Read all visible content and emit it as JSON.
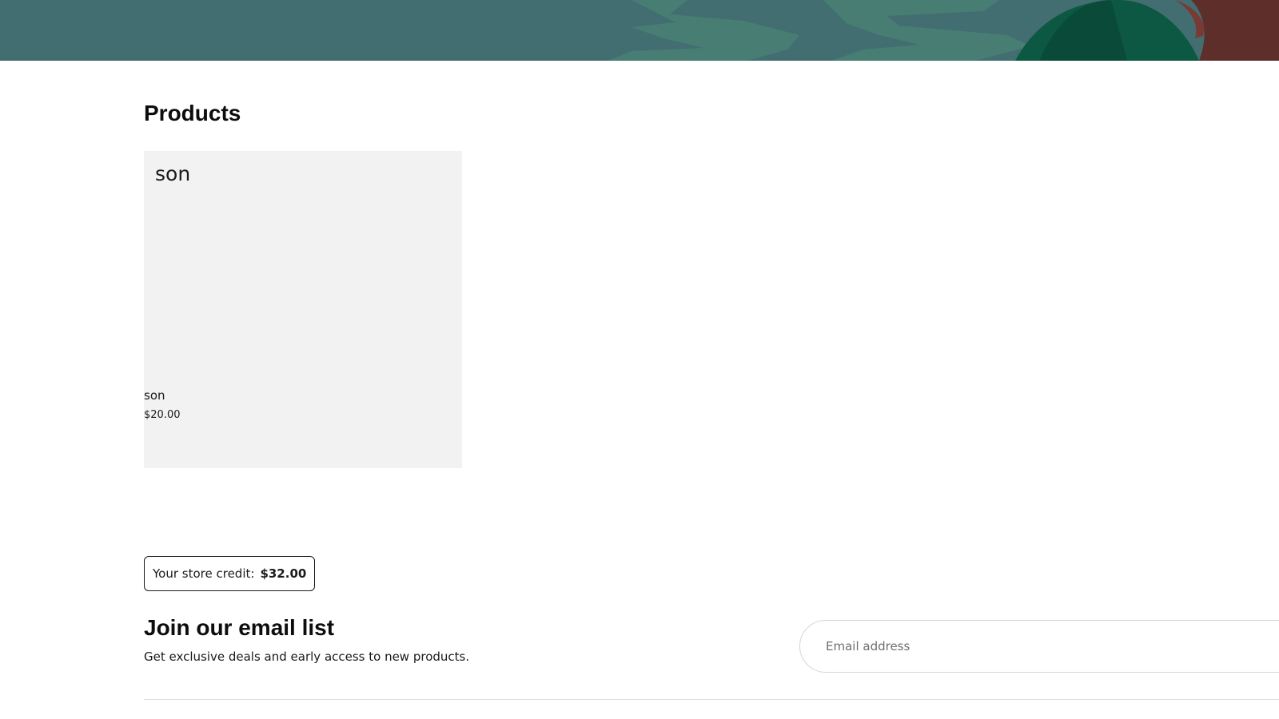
{
  "colors": {
    "banner_bg": "#426e72",
    "banner_leaf_light": "#477d72",
    "banner_leaf_dark": "#0d5842",
    "banner_accent": "#5e2e2b",
    "card_bg": "#f2f2f2"
  },
  "products": {
    "title": "Products",
    "items": [
      {
        "image_text": "son",
        "name": "son",
        "price": "$20.00"
      }
    ]
  },
  "store_credit": {
    "label": "Your store credit:",
    "amount": "$32.00"
  },
  "newsletter": {
    "title": "Join our email list",
    "subtitle": "Get exclusive deals and early access to new products.",
    "email_placeholder": "Email address"
  }
}
